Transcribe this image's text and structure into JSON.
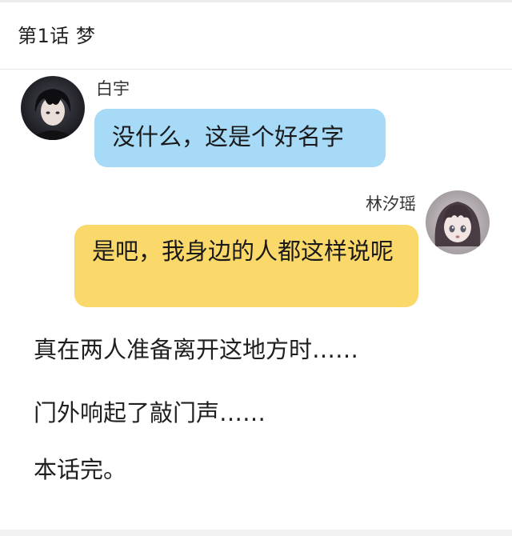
{
  "header": {
    "title": "第1话  梦"
  },
  "messages": [
    {
      "side": "left",
      "sender": "白宇",
      "avatar_icon": "avatar-boy-dark-hair-icon",
      "text": "没什么，这是个好名字",
      "bubble_color": "#a6daf7"
    },
    {
      "side": "right",
      "sender": "林汐瑶",
      "avatar_icon": "avatar-girl-bangs-icon",
      "text": "是吧，我身边的人都这样说呢",
      "bubble_color": "#fbd86a"
    }
  ],
  "narration": [
    "真在两人准备离开这地方时……",
    "门外响起了敲门声……",
    "本话完。"
  ]
}
